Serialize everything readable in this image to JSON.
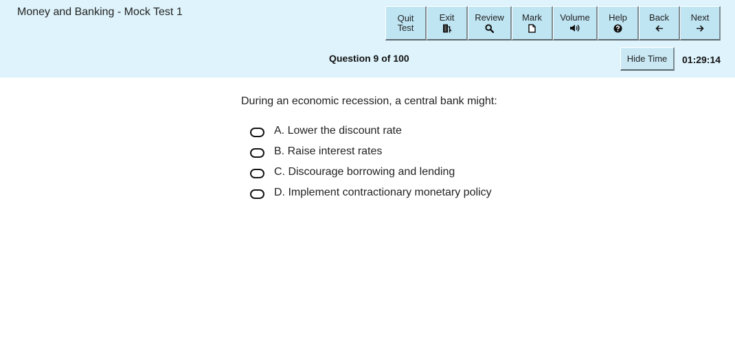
{
  "test": {
    "title": "Money and Banking - Mock Test 1"
  },
  "toolbar": {
    "buttons": [
      {
        "id": "quit",
        "label": "Quit\nTest",
        "icon": ""
      },
      {
        "id": "exit",
        "label": "Exit",
        "icon": "exit-door-icon"
      },
      {
        "id": "review",
        "label": "Review",
        "icon": "magnifier-icon"
      },
      {
        "id": "mark",
        "label": "Mark",
        "icon": "document-icon"
      },
      {
        "id": "volume",
        "label": "Volume",
        "icon": "speaker-icon"
      },
      {
        "id": "help",
        "label": "Help",
        "icon": "question-circle-icon"
      },
      {
        "id": "back",
        "label": "Back",
        "icon": "arrow-left-icon"
      },
      {
        "id": "next",
        "label": "Next",
        "icon": "arrow-right-icon"
      }
    ]
  },
  "status": {
    "question_counter": "Question 9 of 100",
    "hide_time_label": "Hide Time",
    "time_remaining": "01:29:14"
  },
  "question": {
    "text": "During an economic recession, a central bank might:",
    "options": [
      {
        "label": "A. Lower the discount rate"
      },
      {
        "label": "B. Raise interest rates"
      },
      {
        "label": "C. Discourage borrowing and lending"
      },
      {
        "label": "D. Implement contractionary monetary policy"
      }
    ]
  },
  "colors": {
    "header_bg": "#def3fb",
    "button_bg": "#bfe4f2"
  }
}
